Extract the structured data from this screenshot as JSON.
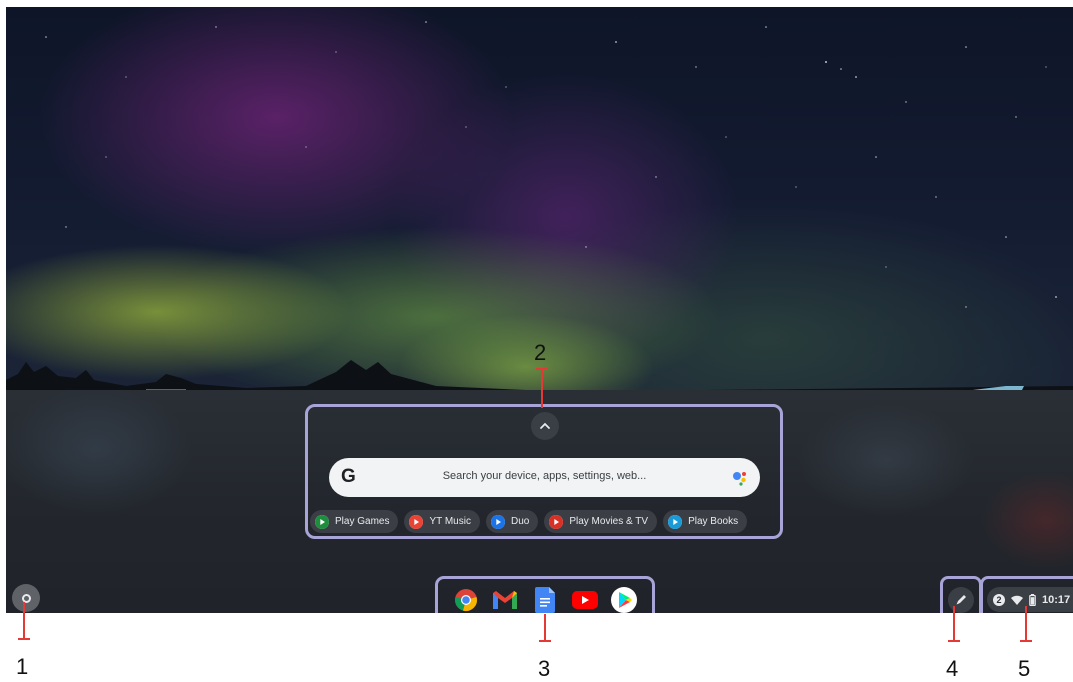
{
  "launcher": {
    "search_placeholder": "Search your device, apps, settings, web...",
    "google_letter": "G",
    "chips": [
      {
        "label": "Play Games",
        "icon": "play-games-icon",
        "color": "#1e8e3e"
      },
      {
        "label": "YT Music",
        "icon": "yt-music-icon",
        "color": "#ea4335"
      },
      {
        "label": "Duo",
        "icon": "duo-icon",
        "color": "#1a73e8"
      },
      {
        "label": "Play Movies & TV",
        "icon": "play-movies-icon",
        "color": "#d93025"
      },
      {
        "label": "Play Books",
        "icon": "play-books-icon",
        "color": "#1a9bd7"
      }
    ]
  },
  "shelf": {
    "pinned_apps": [
      {
        "name": "Chrome",
        "icon": "chrome-icon"
      },
      {
        "name": "Gmail",
        "icon": "gmail-icon"
      },
      {
        "name": "Docs",
        "icon": "docs-icon"
      },
      {
        "name": "YouTube",
        "icon": "youtube-icon"
      },
      {
        "name": "Play Store",
        "icon": "play-store-icon"
      }
    ]
  },
  "status": {
    "notification_count": "2",
    "time": "10:17"
  },
  "callouts": [
    "1",
    "2",
    "3",
    "4",
    "5"
  ],
  "colors": {
    "callout_border": "#a8a4d8",
    "leader_line": "#e53935"
  }
}
